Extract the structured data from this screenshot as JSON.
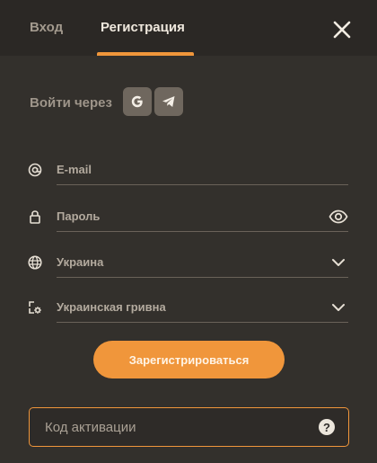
{
  "tabs": {
    "login": "Вход",
    "register": "Регистрация"
  },
  "social": {
    "label": "Войти через",
    "providers": [
      "google-icon",
      "telegram-icon"
    ]
  },
  "fields": {
    "email": {
      "placeholder": "E-mail",
      "icon": "at-icon"
    },
    "password": {
      "placeholder": "Пароль",
      "icon": "lock-icon",
      "toggle_icon": "eye-icon"
    },
    "country": {
      "value": "Украина",
      "icon": "globe-icon"
    },
    "currency": {
      "value": "Украинская гривна",
      "icon": "currency-icon"
    }
  },
  "submit_label": "Зарегистрироваться",
  "promo": {
    "placeholder": "Код активации",
    "help": "?"
  },
  "colors": {
    "accent": "#f0963b",
    "background": "#33302c",
    "header": "#2b2825"
  }
}
